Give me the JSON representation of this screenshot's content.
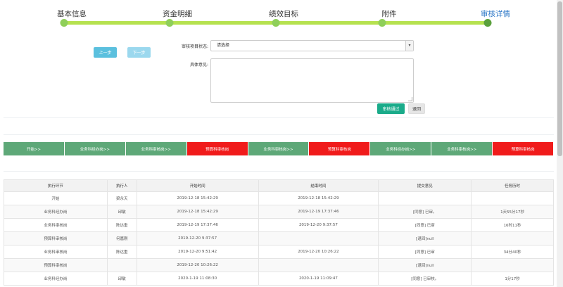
{
  "stepper": {
    "steps": [
      {
        "label": "基本信息",
        "active": false
      },
      {
        "label": "资金明细",
        "active": false
      },
      {
        "label": "绩效目标",
        "active": false
      },
      {
        "label": "附件",
        "active": false
      },
      {
        "label": "审核详情",
        "active": true
      }
    ]
  },
  "nav": {
    "prev_label": "上一步",
    "next_label": "下一步"
  },
  "form": {
    "status_label": "审核项目状态:",
    "status_value": "请选择",
    "opinion_label": "具体意见:",
    "opinion_value": "",
    "pass_label": "审核通过",
    "back_label": "退回"
  },
  "flow": {
    "nodes": [
      {
        "label": "开始>>",
        "color": "#5ea878"
      },
      {
        "label": "业务科经办岗>>",
        "color": "#5ea878"
      },
      {
        "label": "业务科审核岗>>",
        "color": "#5ea878"
      },
      {
        "label": "预算科审核岗",
        "color": "#f01b1b"
      },
      {
        "label": "业务科审核岗>>",
        "color": "#5ea878"
      },
      {
        "label": "预算科审核岗",
        "color": "#f01b1b"
      },
      {
        "label": "业务科经办岗>>",
        "color": "#5ea878"
      },
      {
        "label": "业务科审核岗>>",
        "color": "#5ea878"
      },
      {
        "label": "预算科审核岗",
        "color": "#f01b1b"
      }
    ]
  },
  "log": {
    "headers": [
      "执行环节",
      "执行人",
      "开始时间",
      "结束时间",
      "提交意见",
      "任务历时"
    ],
    "rows": [
      [
        "开始",
        "梁永天",
        "2019-12-18 15:42:29",
        "2019-12-18 15:42:29",
        "",
        ""
      ],
      [
        "业务科经办岗",
        "邱敏",
        "2019-12-18 15:42:29",
        "2019-12-19 17:37:46",
        "[同意] 已审。",
        "1天55分17秒"
      ],
      [
        "业务科审核岗",
        "陈达重",
        "2019-12-19 17:37:46",
        "2019-12-20 9:37:57",
        "[同意] 已审",
        "16时11秒"
      ],
      [
        "预算科审核岗",
        "何嘉刚",
        "2019-12-20 9:37:57",
        "",
        "[退回]null",
        ""
      ],
      [
        "业务科审核岗",
        "陈达重",
        "2019-12-20 9:51:42",
        "2019-12-20 10:26:22",
        "[同意] 已审",
        "34分40秒"
      ],
      [
        "预算科审核岗",
        "",
        "2019-12-20 10:26:22",
        "",
        "[退回]null",
        ""
      ],
      [
        "业务科经办岗",
        "邱敏",
        "2020-1-19 11:08:30",
        "2020-1-19 11:09:47",
        "[同意] 已审核。",
        "1分17秒"
      ]
    ]
  }
}
